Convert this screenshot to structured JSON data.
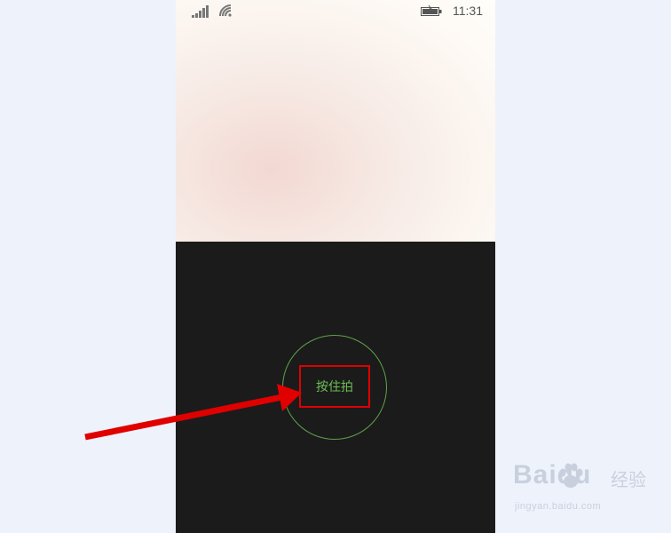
{
  "status_bar": {
    "time": "11:31",
    "icons": [
      "signal-icon",
      "wifi-icon",
      "battery-icon"
    ]
  },
  "camera": {
    "shutter_label": "按住拍"
  },
  "watermark": {
    "logo": "Baidu",
    "product": "经验",
    "url": "jingyan.baidu.com"
  },
  "colors": {
    "page_background": "#eef2fb",
    "control_background": "#1b1b1b",
    "shutter_ring": "#5fa14a",
    "shutter_text": "#6cbf55",
    "annotation": "#e00000"
  }
}
